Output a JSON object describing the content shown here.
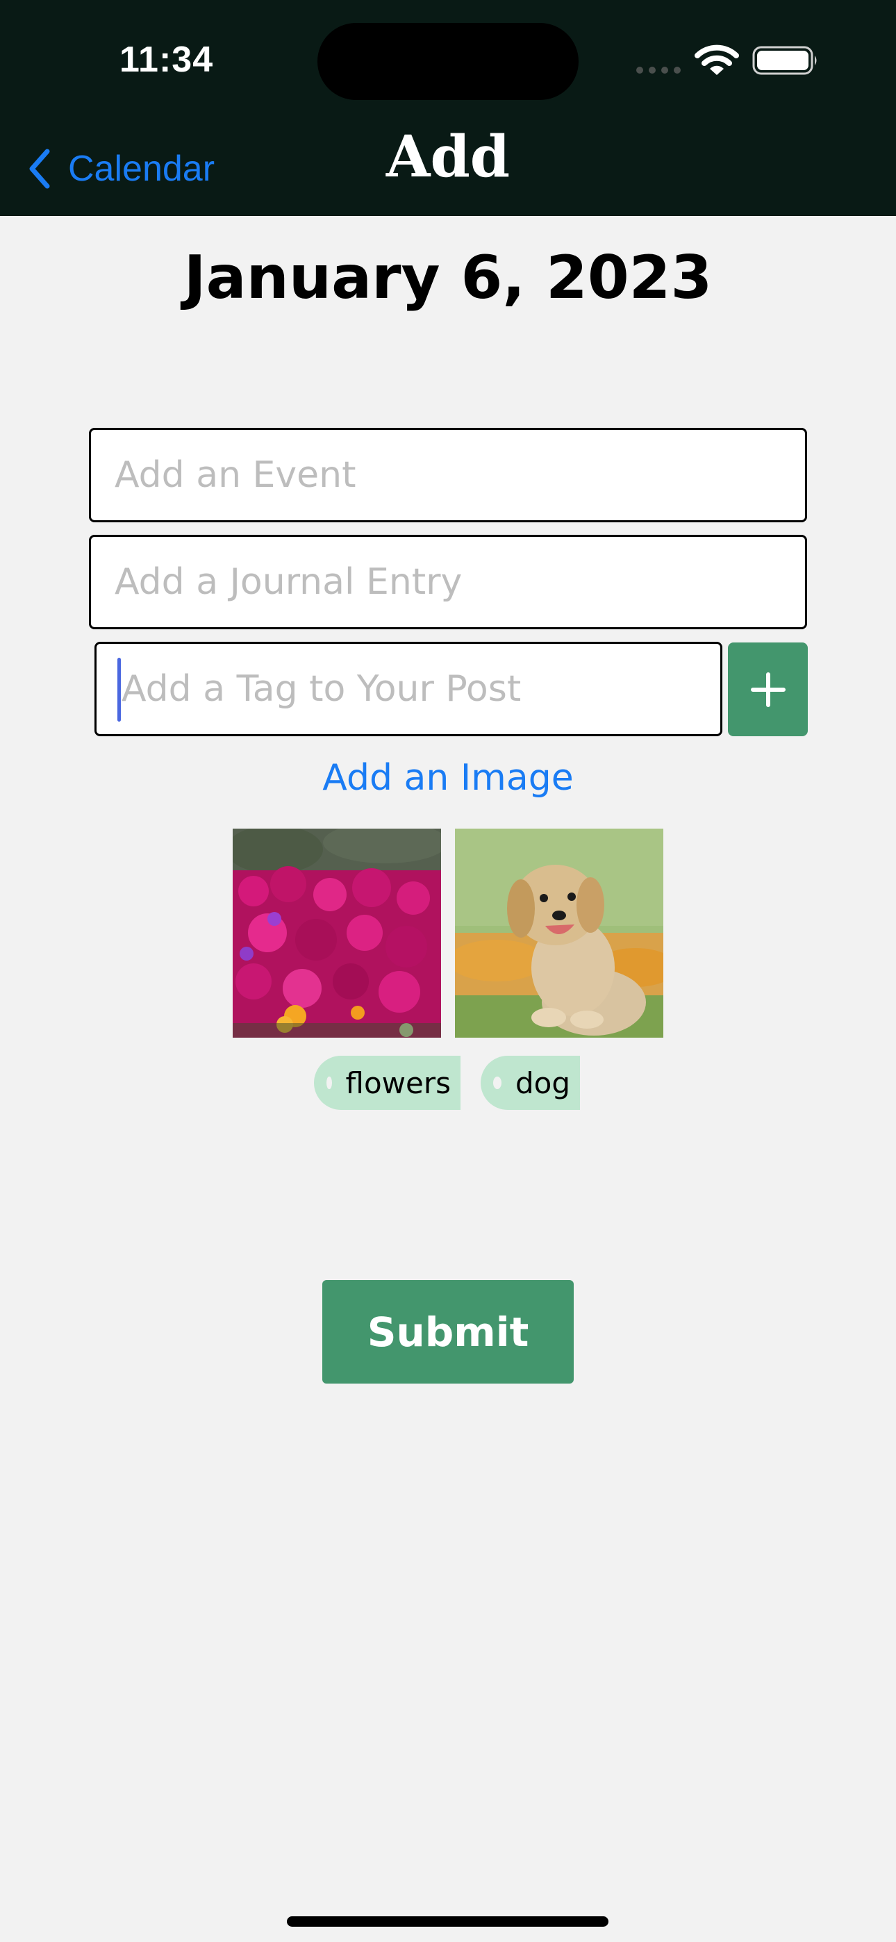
{
  "status_bar": {
    "time": "11:34"
  },
  "nav": {
    "back_label": "Calendar",
    "title": "Add"
  },
  "date": "January 6, 2023",
  "form": {
    "event_placeholder": "Add an Event",
    "journal_placeholder": "Add a Journal Entry",
    "tag_placeholder": "Add a Tag to Your Post",
    "add_tag_icon": "plus-icon",
    "add_image_label": "Add an Image",
    "submit_label": "Submit"
  },
  "images": [
    {
      "subject": "flowers-photo"
    },
    {
      "subject": "dog-photo"
    }
  ],
  "tags": [
    {
      "label": "flowers"
    },
    {
      "label": "dog"
    }
  ],
  "colors": {
    "header_bg": "#091a15",
    "accent_green": "#43966d",
    "tag_bg": "#bfe6cf",
    "link_blue": "#1a7cf4",
    "page_bg": "#f2f2f2"
  }
}
